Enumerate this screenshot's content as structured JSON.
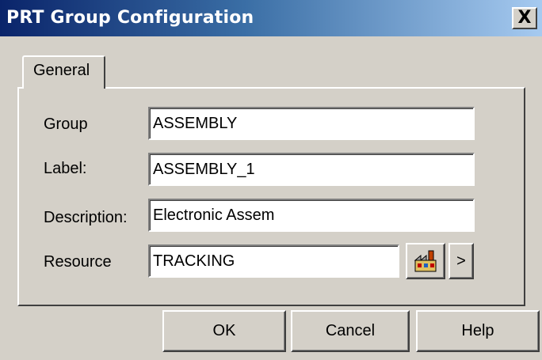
{
  "window": {
    "title": "PRT Group Configuration",
    "close_label": "X"
  },
  "tabs": [
    {
      "label": "General",
      "selected": true
    }
  ],
  "form": {
    "group": {
      "label": "Group",
      "value": "ASSEMBLY"
    },
    "label_field": {
      "label": "Label:",
      "value": "ASSEMBLY_1"
    },
    "description": {
      "label": "Description:",
      "value": "Electronic Assem"
    },
    "resource": {
      "label": "Resource",
      "value": "TRACKING",
      "browse_icon": "factory-icon",
      "more_label": ">"
    }
  },
  "buttons": {
    "ok": "OK",
    "cancel": "Cancel",
    "help": "Help"
  },
  "colors": {
    "title_start": "#0a246a",
    "title_end": "#a6caf0",
    "face": "#d4d0c8"
  }
}
